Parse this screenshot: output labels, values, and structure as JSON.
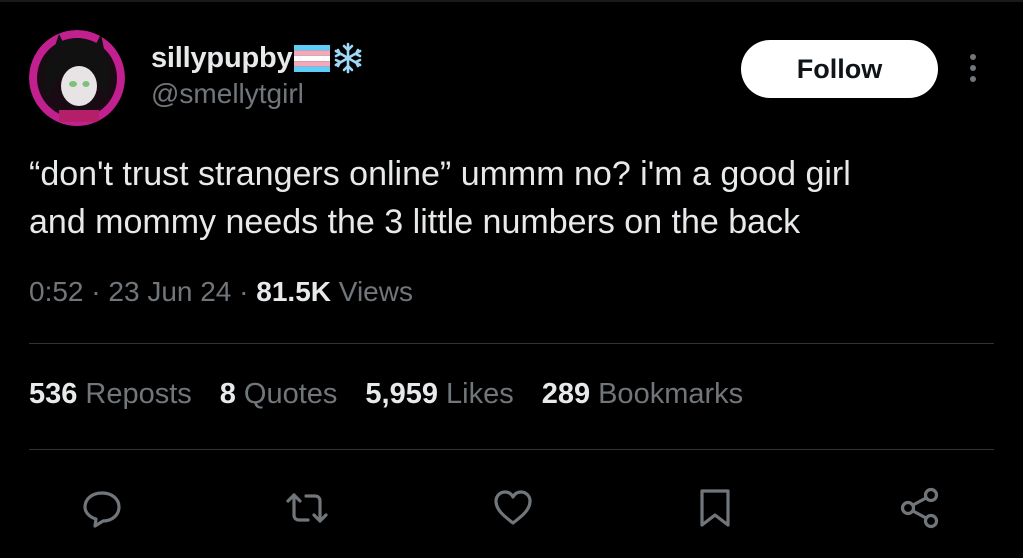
{
  "user": {
    "display_name": "sillypupby",
    "handle": "@smellytgirl",
    "badges": [
      "transgender-flag-icon",
      "snowflake-icon"
    ]
  },
  "header": {
    "follow_label": "Follow",
    "more_icon": "more-vertical-icon"
  },
  "tweet": {
    "text_line1": "“don't trust strangers online” ummm no? i'm a good girl",
    "text_line2": "and mommy needs the 3 little numbers on the back",
    "time": "0:52",
    "date": "23 Jun 24",
    "sep": "·",
    "views_count": "81.5K",
    "views_label": "Views"
  },
  "stats": {
    "reposts_count": "536",
    "reposts_label": "Reposts",
    "quotes_count": "8",
    "quotes_label": "Quotes",
    "likes_count": "5,959",
    "likes_label": "Likes",
    "bookmarks_count": "289",
    "bookmarks_label": "Bookmarks"
  },
  "actions": [
    "reply-icon",
    "repost-icon",
    "like-icon",
    "bookmark-icon",
    "share-icon"
  ],
  "colors": {
    "background": "#000000",
    "primary_text": "#e7e9ea",
    "secondary_text": "#71767b",
    "divider": "#2f3336",
    "follow_bg": "#ffffff",
    "follow_text": "#0f1419",
    "avatar_ring": "#c2208f",
    "trans_blue": "#5bcefa",
    "trans_pink": "#f5a9b8",
    "snowflake": "#9fd8f7"
  }
}
